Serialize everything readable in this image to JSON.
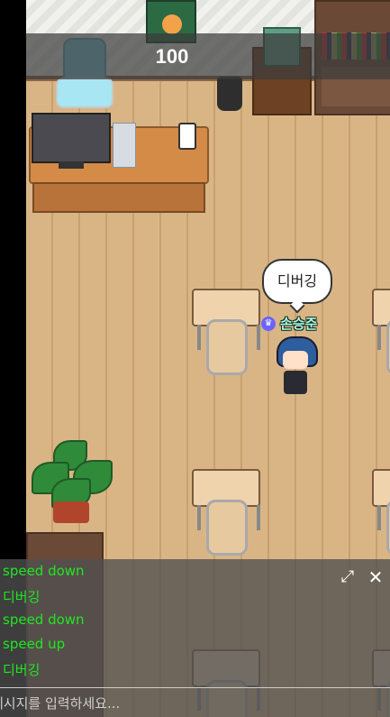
{
  "hud": {
    "score": "100"
  },
  "player": {
    "name": "손승준",
    "speech": "디버깅",
    "badge_icon": "crown-icon"
  },
  "chat": {
    "messages": [
      "speed down",
      "디버깅",
      "speed down",
      "speed up",
      "디버깅"
    ],
    "input_placeholder": "메시지를 입력하세요...",
    "expand_icon": "expand-icon",
    "close_icon": "close-icon"
  },
  "colors": {
    "chat_text": "#21e621",
    "name_text": "#a7ffe0",
    "badge": "#6c63ff"
  }
}
